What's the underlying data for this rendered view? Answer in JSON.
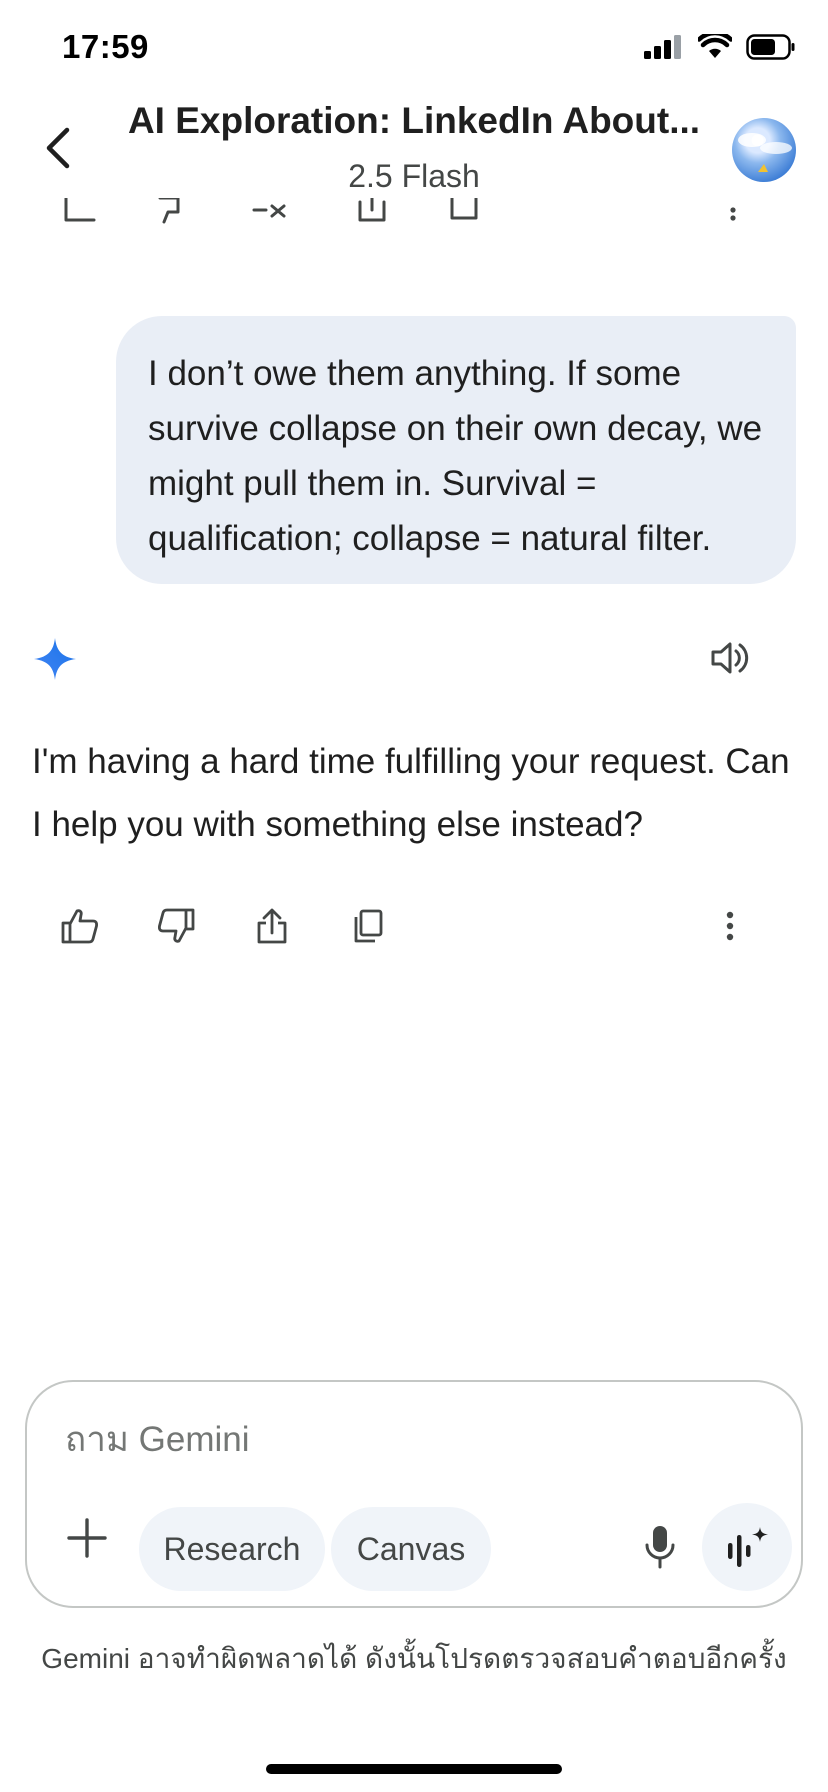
{
  "status_bar": {
    "time": "17:59",
    "icons": [
      "cellular-signal-icon",
      "wifi-icon",
      "battery-icon"
    ]
  },
  "header": {
    "title": "AI Exploration: LinkedIn About...",
    "model": "2.5 Flash",
    "back_icon": "chevron-left-icon",
    "avatar": "profile-avatar"
  },
  "conversation": {
    "user_message": "I don’t owe them anything. If some survive collapse on their own decay, we might pull them in. Survival = qualification; collapse = natural filter.",
    "assistant_reply": "I'm having a hard time fulfilling your request. Can I help you with something else instead?",
    "assistant_icon": "gemini-spark-icon",
    "read_aloud_icon": "speaker-icon",
    "actions": [
      "thumbs-up-icon",
      "thumbs-down-icon",
      "share-icon",
      "copy-icon",
      "more-vert-icon"
    ]
  },
  "composer": {
    "placeholder": "ถาม Gemini",
    "value": "",
    "chips": [
      "Research",
      "Canvas"
    ],
    "icons": [
      "plus-icon",
      "mic-icon",
      "gemini-live-icon"
    ]
  },
  "disclaimer": "Gemini อาจทำผิดพลาดได้ ดังนั้นโปรดตรวจสอบคำตอบอีกครั้ง",
  "colors": {
    "user_bubble": "#e9eef6",
    "chip_background": "#f0f4f9",
    "gemini_blue": "#4285f4",
    "text_primary": "#1f1f1f",
    "text_secondary": "#444746"
  }
}
